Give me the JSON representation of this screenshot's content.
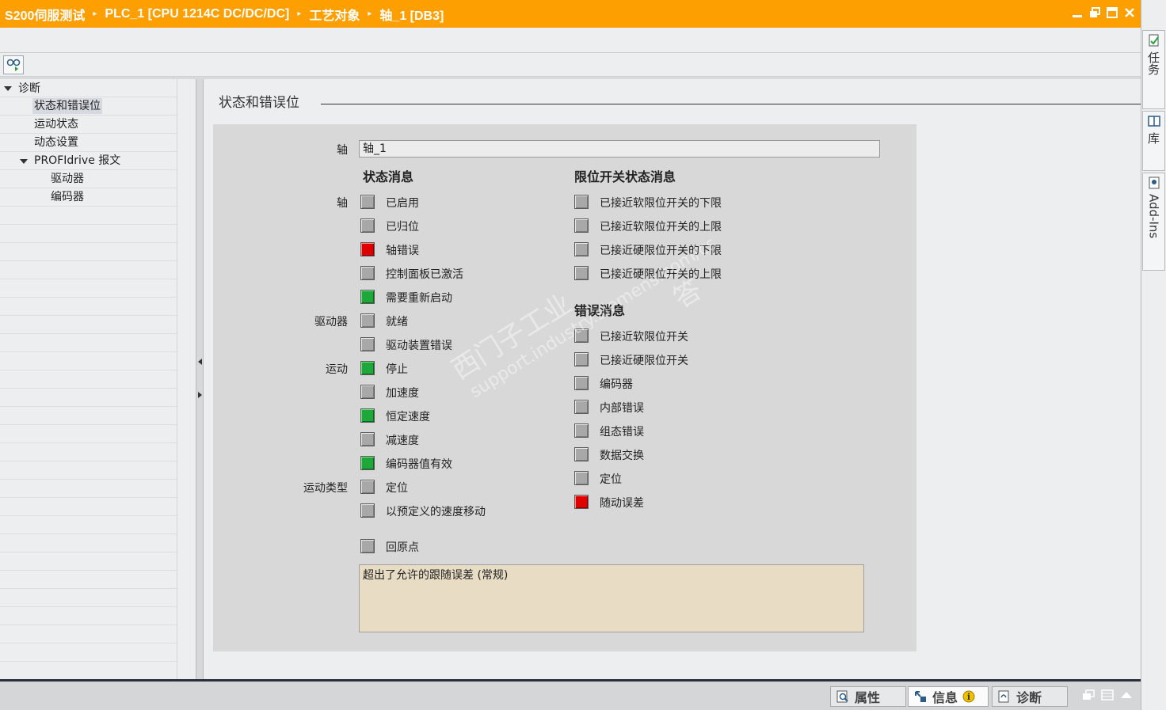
{
  "titlebar": {
    "crumbs": [
      "S200伺服测试",
      "PLC_1 [CPU 1214C DC/DC/DC]",
      "工艺对象",
      "轴_1 [DB3]"
    ]
  },
  "nav": {
    "root": "诊断",
    "items": [
      "状态和错误位",
      "运动状态",
      "动态设置"
    ],
    "profidrive": "PROFIdrive 报文",
    "profidrive_items": [
      "驱动器",
      "编码器"
    ]
  },
  "main": {
    "section_title": "状态和错误位",
    "axis_label": "轴",
    "axis_value": "轴_1",
    "status_header": "状态消息",
    "limit_header": "限位开关状态消息",
    "error_header": "错误消息",
    "groups": {
      "axis": "轴",
      "drive": "驱动器",
      "motion": "运动",
      "motion_type": "运动类型"
    },
    "status_items": [
      {
        "label": "已启用",
        "state": "grey"
      },
      {
        "label": "已归位",
        "state": "grey"
      },
      {
        "label": "轴错误",
        "state": "red"
      },
      {
        "label": "控制面板已激活",
        "state": "grey"
      },
      {
        "label": "需要重新启动",
        "state": "green"
      },
      {
        "label": "就绪",
        "state": "grey"
      },
      {
        "label": "驱动装置错误",
        "state": "grey"
      },
      {
        "label": "停止",
        "state": "green"
      },
      {
        "label": "加速度",
        "state": "grey"
      },
      {
        "label": "恒定速度",
        "state": "green"
      },
      {
        "label": "减速度",
        "state": "grey"
      },
      {
        "label": "编码器值有效",
        "state": "green"
      },
      {
        "label": "定位",
        "state": "grey"
      },
      {
        "label": "以预定义的速度移动",
        "state": "grey"
      },
      {
        "label": "回原点",
        "state": "grey"
      }
    ],
    "limit_items": [
      {
        "label": "已接近软限位开关的下限",
        "state": "grey"
      },
      {
        "label": "已接近软限位开关的上限",
        "state": "grey"
      },
      {
        "label": "已接近硬限位开关的下限",
        "state": "grey"
      },
      {
        "label": "已接近硬限位开关的上限",
        "state": "grey"
      }
    ],
    "error_items": [
      {
        "label": "已接近软限位开关",
        "state": "grey"
      },
      {
        "label": "已接近硬限位开关",
        "state": "grey"
      },
      {
        "label": "编码器",
        "state": "grey"
      },
      {
        "label": "内部错误",
        "state": "grey"
      },
      {
        "label": "组态错误",
        "state": "grey"
      },
      {
        "label": "数据交换",
        "state": "grey"
      },
      {
        "label": "定位",
        "state": "grey"
      },
      {
        "label": "随动误差",
        "state": "red"
      }
    ],
    "message": "超出了允许的跟随误差 (常规)",
    "watermark_line1": "西门子工业",
    "watermark_line2": "support.industry.siemens.com/cs",
    "watermark_line3": "答"
  },
  "side_tabs": [
    "任务",
    "库",
    "Add-Ins"
  ],
  "bottom_tabs": [
    "属性",
    "信息",
    "诊断"
  ],
  "colors": {
    "title_bar": "#fd9f00",
    "led_green": "#1ea83a",
    "led_red": "#e00000",
    "led_grey": "#a8a8a8",
    "message_bg": "#e8dcc4"
  }
}
